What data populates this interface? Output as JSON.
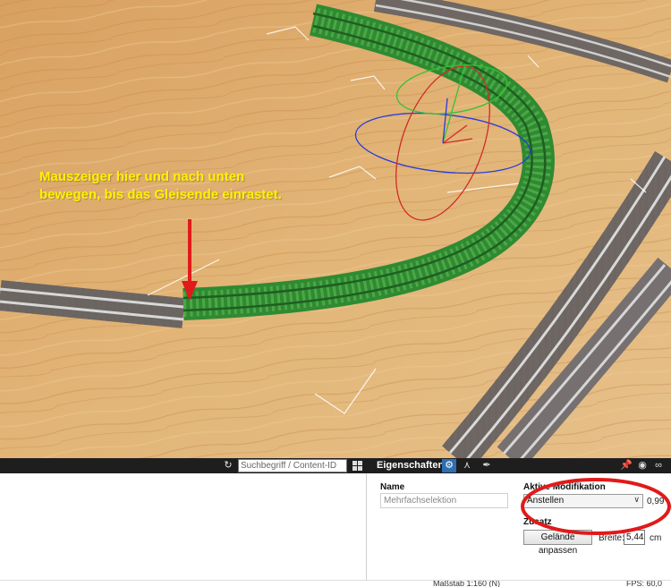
{
  "instruction": {
    "line1": "Mauszeiger hier und nach unten",
    "line2": "bewegen, bis das Gleisende einrastet."
  },
  "catalog": {
    "search_placeholder": "Suchbegriff / Content-ID",
    "refresh_icon": "refresh-icon",
    "grid_icon": "grid-view-icon",
    "scroll_icon": "chevron-right-icon"
  },
  "properties": {
    "title": "Eigenschaften",
    "tabs": [
      "settings-icon",
      "hierarchy-icon",
      "paint-icon"
    ],
    "window_icons": [
      "pin-icon",
      "eye-icon",
      "link-icon"
    ],
    "name_label": "Name",
    "name_value": "Mehrfachselektion",
    "modification_label": "Aktive Modifikation",
    "modification_value": "Anstellen",
    "modification_amount": "0,99",
    "extra_label": "Zusatz",
    "terrain_button": "Gelände anpassen",
    "width_label": "Breite:",
    "width_value": "5,44",
    "width_unit": "cm"
  },
  "status": {
    "scale": "Maßstab 1:160 (N)",
    "fps": "FPS: 60,0"
  },
  "colors": {
    "wood": "#d9a864",
    "track_selected": "#3e9a3a",
    "annotation_arrow": "#e11a1a",
    "annotation_text": "#fff200",
    "panel_header": "#1e1e1e",
    "active_tab": "#2f6fb0"
  }
}
